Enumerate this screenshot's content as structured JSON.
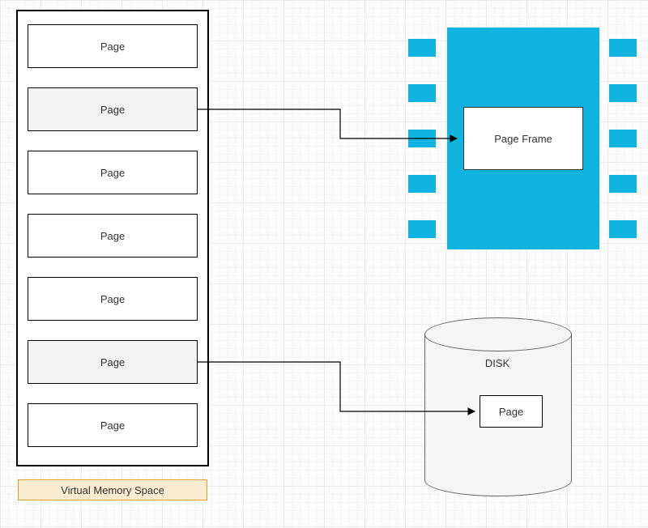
{
  "vm": {
    "title": "Virtual Memory Space",
    "pages": [
      {
        "label": "Page",
        "shaded": false
      },
      {
        "label": "Page",
        "shaded": true
      },
      {
        "label": "Page",
        "shaded": false
      },
      {
        "label": "Page",
        "shaded": false
      },
      {
        "label": "Page",
        "shaded": false
      },
      {
        "label": "Page",
        "shaded": true
      },
      {
        "label": "Page",
        "shaded": false
      }
    ]
  },
  "ram": {
    "frame_label": "Page Frame",
    "color": "#10b4e0"
  },
  "disk": {
    "title": "DISK",
    "page_label": "Page"
  }
}
